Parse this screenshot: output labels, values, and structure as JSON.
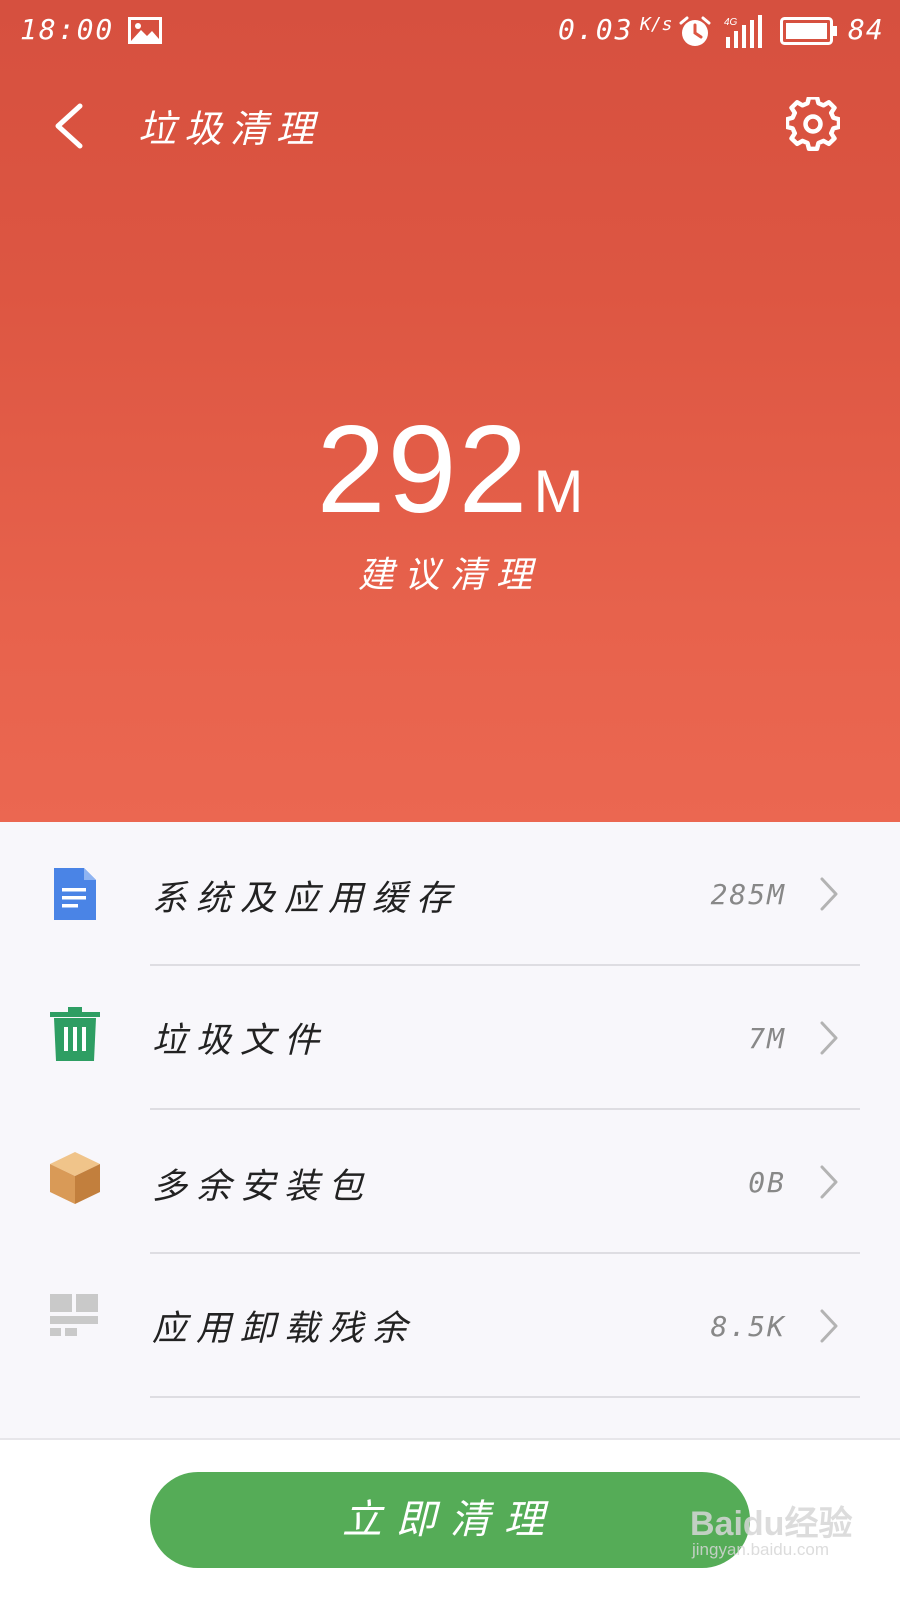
{
  "status_bar": {
    "time": "18:00",
    "net_speed": "0.03",
    "net_unit": "K/s",
    "signal_label": "4G",
    "battery_level": "84",
    "icons": [
      "image-icon",
      "alarm-icon",
      "signal-icon",
      "battery-icon"
    ]
  },
  "header": {
    "title": "垃圾清理",
    "junk_size": "292",
    "junk_unit": "M",
    "caption": "建议清理",
    "background_color": "#e05a45"
  },
  "list": {
    "items": [
      {
        "label": "系统及应用缓存",
        "size": "285M",
        "icon": "document-icon",
        "icon_color": "#4a84e6"
      },
      {
        "label": "垃圾文件",
        "size": "7M",
        "icon": "trash-icon",
        "icon_color": "#2e9e63"
      },
      {
        "label": "多余安装包",
        "size": "0B",
        "icon": "package-box-icon",
        "icon_color": "#d99a57"
      },
      {
        "label": "应用卸载残余",
        "size": "8.5K",
        "icon": "residue-grid-icon",
        "icon_color": "#c7c7c7"
      }
    ]
  },
  "bottom": {
    "clean_button_label": "立即清理",
    "button_color": "#55ac57",
    "watermark_main": "Baidu经验",
    "watermark_sub": "jingyan.baidu.com"
  }
}
